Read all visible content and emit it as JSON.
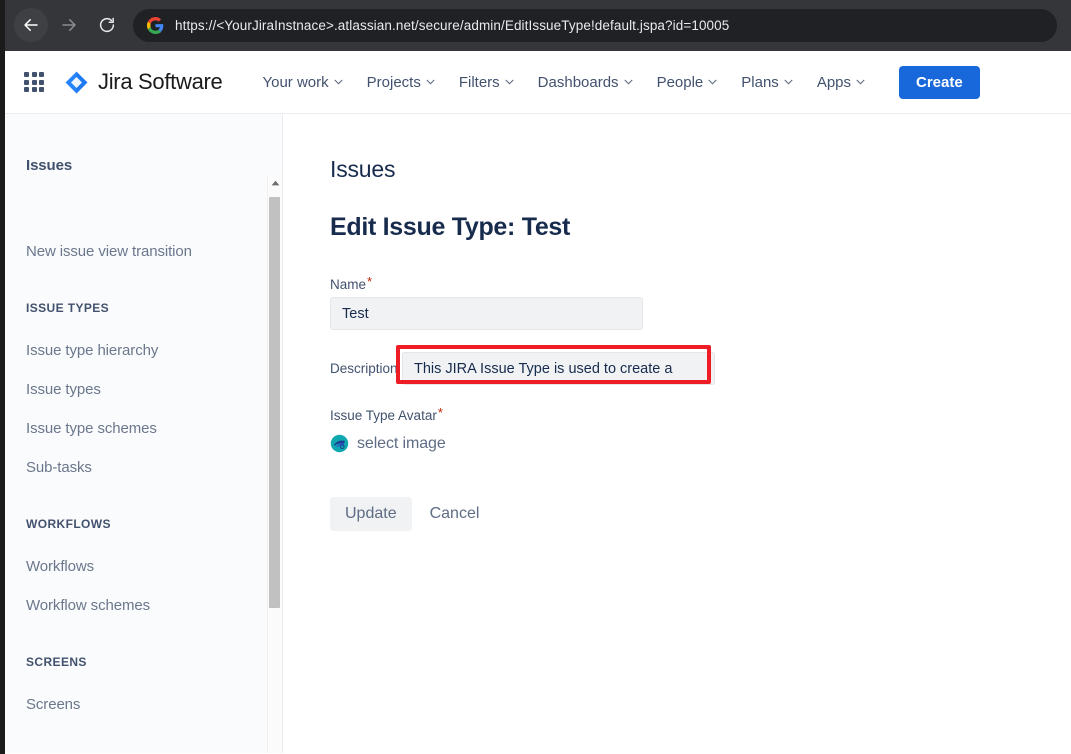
{
  "browser": {
    "back_icon": "arrow-left-icon",
    "forward_icon": "arrow-right-icon",
    "reload_icon": "reload-icon",
    "site_icon": "google-icon",
    "url": "https://<YourJiraInstnace>.atlassian.net/secure/admin/EditIssueType!default.jspa?id=10005"
  },
  "topnav": {
    "app_switcher_icon": "grid-apps-icon",
    "product_logo_icon": "jira-diamond-icon",
    "product_name": "Jira Software",
    "links": [
      {
        "label": "Your work",
        "caret": "chevron-down-icon"
      },
      {
        "label": "Projects",
        "caret": "chevron-down-icon"
      },
      {
        "label": "Filters",
        "caret": "chevron-down-icon"
      },
      {
        "label": "Dashboards",
        "caret": "chevron-down-icon"
      },
      {
        "label": "People",
        "caret": "chevron-down-icon"
      },
      {
        "label": "Plans",
        "caret": "chevron-down-icon"
      },
      {
        "label": "Apps",
        "caret": "chevron-down-icon"
      }
    ],
    "create_label": "Create",
    "create_color": "#1868db"
  },
  "sidebar": {
    "header": "Issues",
    "item_new_issue_view": "New issue view transition",
    "section_issue_types": "ISSUE TYPES",
    "item_issue_type_hierarchy": "Issue type hierarchy",
    "item_issue_types": "Issue types",
    "item_issue_type_schemes": "Issue type schemes",
    "item_sub_tasks": "Sub-tasks",
    "section_workflows": "WORKFLOWS",
    "item_workflows": "Workflows",
    "item_workflow_schemes": "Workflow schemes",
    "section_screens": "SCREENS",
    "item_screens": "Screens",
    "scroll_up_icon": "caret-up-icon"
  },
  "content": {
    "breadcrumb": "Issues",
    "page_title": "Edit Issue Type: Test",
    "name_label": "Name",
    "name_required_marker": "*",
    "name_value": "Test",
    "description_label": "Description",
    "description_value": "This JIRA Issue Type is used to create a",
    "avatar_label": "Issue Type Avatar",
    "avatar_required_marker": "*",
    "avatar_icon": "issue-type-avatar-icon",
    "select_image_label": "select image",
    "update_label": "Update",
    "cancel_label": "Cancel",
    "highlight_color": "#ee1c25"
  }
}
